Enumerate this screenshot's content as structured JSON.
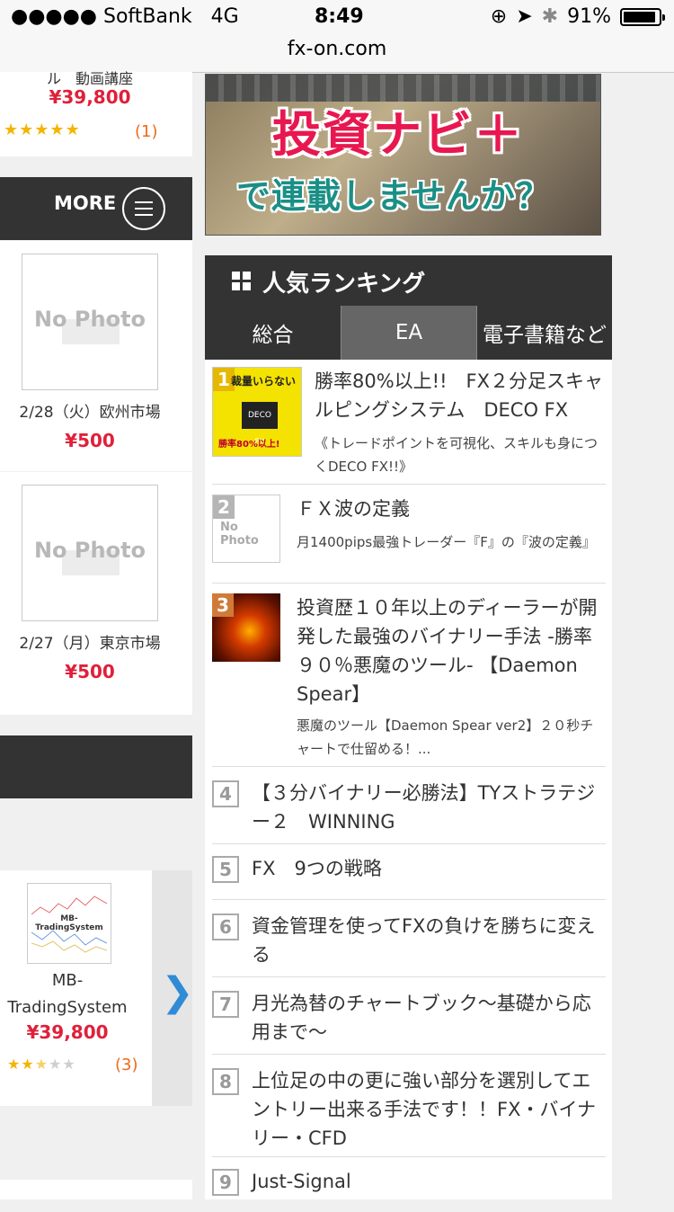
{
  "status_bar": {
    "carrier": "●●●●● SoftBank",
    "network": "4G",
    "time": "8:49",
    "battery": "91%",
    "battery_level": 0.91,
    "url": "fx-on.com"
  },
  "left_column": {
    "top_card": {
      "title_partial": "ル　動画講座",
      "price": "¥39,800",
      "stars": "★★★★★",
      "rating": 5,
      "reviews": "(1)"
    },
    "more_label": "MORE",
    "products": [
      {
        "image": "No Photo",
        "title": "2/28（火）欧州市場",
        "price": "¥500"
      },
      {
        "image": "No Photo",
        "title": "2/27（月）東京市場",
        "price": "¥500"
      }
    ],
    "carousel_item": {
      "image_label": "MB-TradingSystem",
      "title": "MB-TradingSystem",
      "price": "¥39,800",
      "stars": "★★★★★",
      "rating": 2.5,
      "reviews": "(3)",
      "next_icon": "chevron-right-icon"
    }
  },
  "banner": {
    "line1": "投資ナビ＋",
    "line2": "で連載しませんか？"
  },
  "ranking": {
    "title": "人気ランキング",
    "tabs": [
      "総合",
      "EA",
      "電子書籍など"
    ],
    "active_tab": 0,
    "items": [
      {
        "rank": "1",
        "title": "勝率80%以上!!　FX２分足スキャルピングシステム　DECO FX",
        "desc": "《トレードポイントを可視化、スキルも身につくDECO FX!!》",
        "thumb_text": "裁量いらない"
      },
      {
        "rank": "2",
        "title": "ＦＸ波の定義",
        "desc": "月1400pips最強トレーダー『F』の『波の定義』",
        "thumb_text": "No Photo"
      },
      {
        "rank": "3",
        "title": "投資歴１０年以上のディーラーが開発した最強のバイナリー手法 -勝率９０％悪魔のツール- 【Daemon Spear】",
        "desc": "悪魔のツール【Daemon Spear ver2】２０秒チャートで仕留める！..."
      },
      {
        "rank": "4",
        "title": "【３分バイナリー必勝法】TYストラテジー２　WINNING"
      },
      {
        "rank": "5",
        "title": "FX　9つの戦略"
      },
      {
        "rank": "6",
        "title": "資金管理を使ってFXの負けを勝ちに変える"
      },
      {
        "rank": "7",
        "title": "月光為替のチャートブック〜基礎から応用まで〜"
      },
      {
        "rank": "8",
        "title": "上位足の中の更に強い部分を選別してエントリー出来る手法です！！FX・バイナリー・CFD"
      },
      {
        "rank": "9",
        "title": "Just-Signal"
      }
    ]
  }
}
